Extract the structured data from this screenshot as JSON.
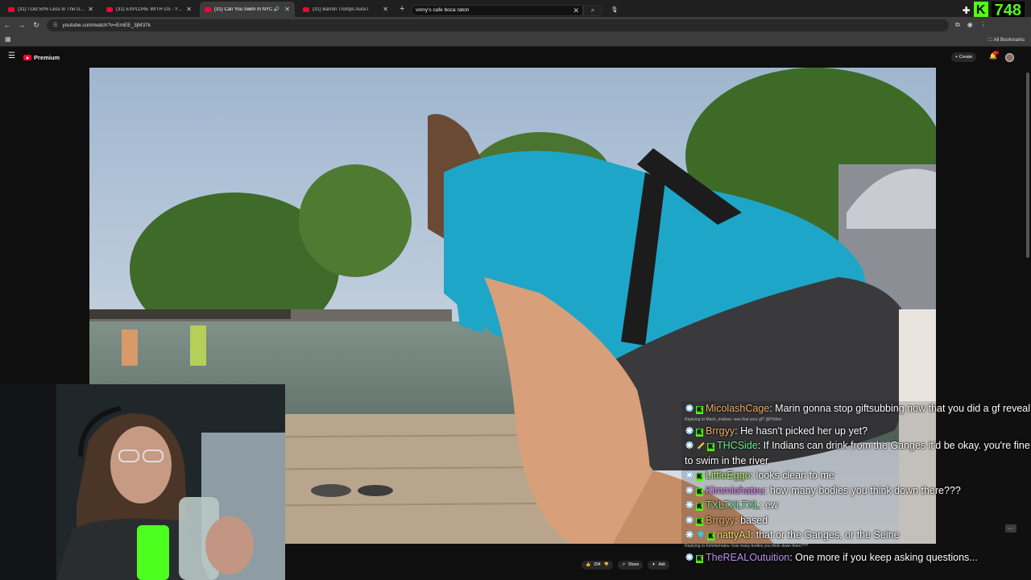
{
  "browser": {
    "tabs": [
      {
        "title": "(31) I Did 50% Less In The Gym",
        "active": false
      },
      {
        "title": "(31) EXPLORE WITH US - YouTube",
        "active": false
      },
      {
        "title": "(31) Can You Swim In NYC",
        "active": true
      },
      {
        "title": "(31) Barron Trumps Aura I",
        "active": false
      }
    ],
    "new_tab": "+",
    "url": "youtube.com/watch?v=EmEE_3jM37k",
    "all_bookmarks": "All Bookmarks",
    "kick_count": "748",
    "kick_logo": "K"
  },
  "youtube": {
    "brand": "Premium",
    "search_query": "vinny's cafe boca raton",
    "create_label": "Create",
    "notif_badge": "9+",
    "like_count": "294",
    "share_label": "Share",
    "ask_label": "Ask",
    "cc_label": "p.o"
  },
  "chat": {
    "messages": [
      {
        "user": "MicolashCage",
        "color": "#f3b16a",
        "text": ": Marin gonna stop giftsubbing now that you did a gf reveal",
        "badges": [
          "star",
          "k"
        ]
      },
      {
        "reply": "Replying to Marin_malone: was that your gf? @Philion"
      },
      {
        "user": "Brrgyy",
        "color": "#f3b16a",
        "text": ": He hasn't picked her up yet?",
        "badges": [
          "star",
          "k"
        ]
      },
      {
        "user": "THCSide",
        "color": "#6ef28a",
        "text": ": If Indians can drink from the Ganges it'd be okay. you're fine to swim in the river",
        "badges": [
          "star",
          "pen",
          "k"
        ]
      },
      {
        "user": "LittleEggo",
        "color": "#b9f26e",
        "text": ": looks clean to me",
        "badges": [
          "star",
          "k"
        ]
      },
      {
        "user": "Kimmiehateu",
        "color": "#e48cf5",
        "text": ": how many bodies you think down there???",
        "badges": [
          "star",
          "k"
        ]
      },
      {
        "user": "TXLTXLTXL",
        "color": "#6ef2a0",
        "text": ": ew",
        "badges": [
          "star",
          "k"
        ]
      },
      {
        "user": "Brrgyy",
        "color": "#f3b16a",
        "text": ": based",
        "badges": [
          "star",
          "k"
        ]
      },
      {
        "user": "nattyAJ",
        "color": "#f3e36e",
        "text": ": that or the Ganges, or the Seine",
        "badges": [
          "star",
          "gem",
          "k"
        ]
      },
      {
        "reply": "Replying to Kimmiehateu: how many bodies you think down there???"
      },
      {
        "user": "TheREALOutuition",
        "color": "#c28cf5",
        "text": ": One more if you keep asking questions...",
        "badges": [
          "star",
          "k"
        ]
      }
    ]
  },
  "colors": {
    "kick_green": "#53fc18",
    "yt_red": "#ff0033"
  }
}
